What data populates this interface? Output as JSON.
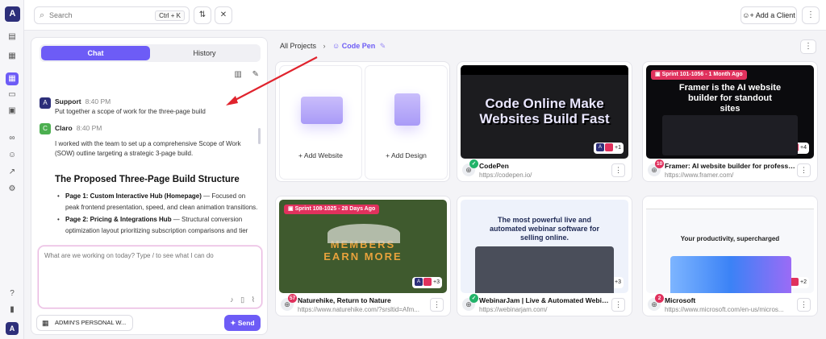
{
  "rail": {
    "logo": "A",
    "icons": [
      "panel-icon",
      "briefcase-icon",
      "grid-icon",
      "inbox-icon",
      "calendar-icon",
      "link-icon",
      "user-icon",
      "chart-icon",
      "settings-icon",
      "help-icon",
      "stats-icon"
    ]
  },
  "topbar": {
    "search_placeholder": "Search",
    "search_shortcut": "Ctrl + K",
    "add_client_label": "Add a Client"
  },
  "chat": {
    "tabs": [
      "Chat",
      "History"
    ],
    "messages": [
      {
        "author": "Support",
        "time": "8:40 PM",
        "text": "Put together a scope of work for the three-page build"
      },
      {
        "author": "Claro",
        "time": "8:40 PM",
        "text": "I worked with the team to set up a comprehensive Scope of Work (SOW) outline targeting a strategic 3-page build."
      }
    ],
    "proposal_title": "The Proposed Three-Page Build Structure",
    "bullets": [
      {
        "bold": "Page 1: Custom Interactive Hub (Homepage)",
        "text": " — Focused on peak frontend presentation, speed, and clean animation transitions."
      },
      {
        "bold": "Page 2: Pricing & Integrations Hub",
        "text": " — Structural conversion optimization layout prioritizing subscription comparisons and tier"
      }
    ],
    "input_placeholder": "What are we working on today? Type / to see what I can do",
    "workspace_label": "ADMIN'S PERSONAL W...",
    "send_label": "Send"
  },
  "breadcrumb": {
    "root": "All Projects",
    "current": "Code Pen"
  },
  "add_cards": [
    {
      "label": "+ Add Website"
    },
    {
      "label": "+ Add Design"
    }
  ],
  "projects": [
    {
      "title": "CodePen",
      "url": "https://codepen.io/",
      "badge": "✓",
      "badge_type": "ok",
      "sprint": "",
      "assignees_extra": "+1",
      "headline": "Code Online Make Websites Build Fast",
      "bg": "#1c1c1f",
      "fg": "#ffffff",
      "accent": "#dcdc3a"
    },
    {
      "title": "Framer: AI website builder for professiona...",
      "url": "https://www.framer.com/",
      "badge": "10",
      "badge_type": "alert",
      "sprint": "Sprint 101-1056 - 1 Month Ago",
      "assignees_extra": "+4",
      "headline": "Framer is the AI website builder for standout sites",
      "bg": "#0b0b0e",
      "fg": "#ffffff",
      "accent": "#3a3a44"
    },
    {
      "title": "Naturehike, Return to Nature",
      "url": "https://www.naturehike.com/?srsltid=Afm...",
      "badge": "57",
      "badge_type": "alert",
      "sprint": "Sprint 108-1025 - 28 Days Ago",
      "assignees_extra": "+3",
      "headline": "MEMBERS EARN MORE",
      "bg": "#3f5a2e",
      "fg": "#e8a23c",
      "accent": "#6f8a46"
    },
    {
      "title": "WebinarJam | Live & Automated Webinar ...",
      "url": "https://webinarjam.com/",
      "badge": "✓",
      "badge_type": "ok",
      "sprint": "",
      "assignees_extra": "+3",
      "headline": "The most powerful live and automated webinar software for selling online.",
      "bg": "#eef2fb",
      "fg": "#1f2a55",
      "accent": "#4a4e5a"
    },
    {
      "title": "Microsoft",
      "url": "https://www.microsoft.com/en-us/micros...",
      "badge": "2",
      "badge_type": "alert",
      "sprint": "",
      "assignees_extra": "+2",
      "headline": "Your productivity, supercharged",
      "bg": "#f7f8fb",
      "fg": "#222222",
      "accent": "#3b82f6"
    }
  ]
}
